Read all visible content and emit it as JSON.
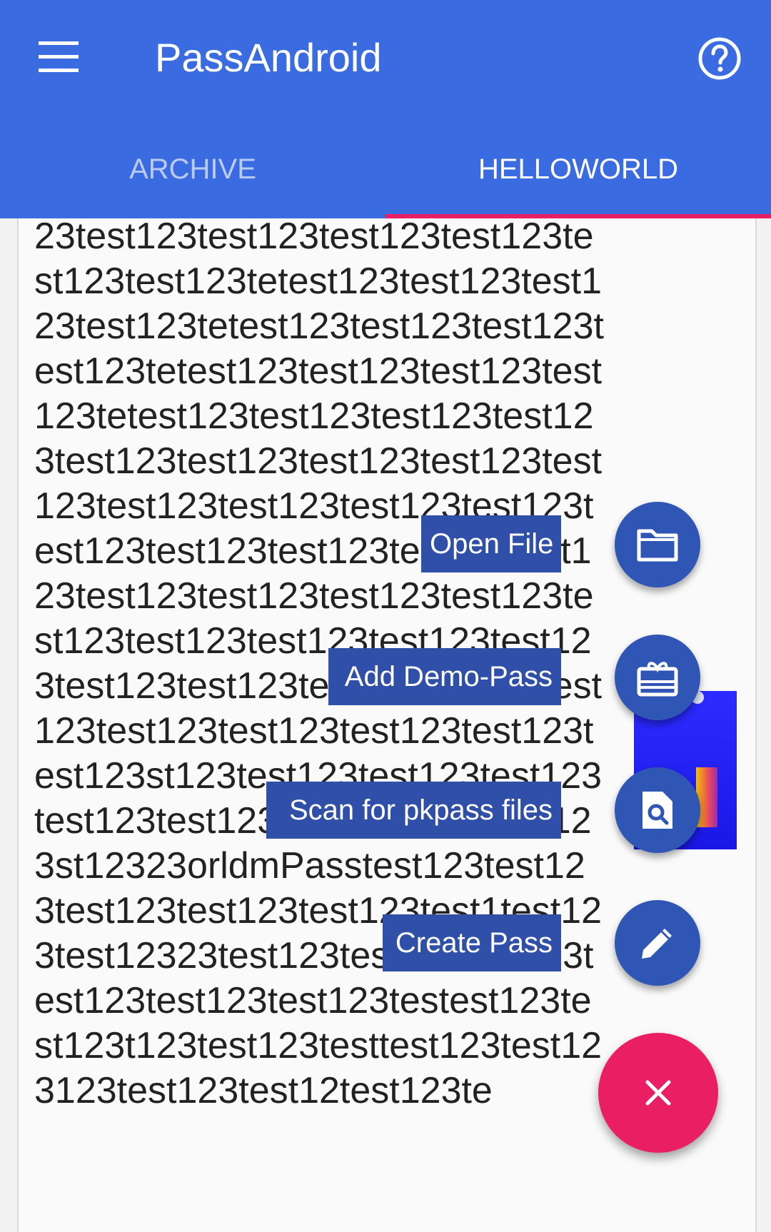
{
  "appbar": {
    "title": "PassAndroid",
    "menu_icon": "hamburger-menu-icon",
    "help_icon": "help-circle-icon",
    "color": "#3A6BE0"
  },
  "tabs": [
    {
      "label": "ARCHIVE",
      "selected": false
    },
    {
      "label": "HELLOWORLD",
      "selected": true
    }
  ],
  "tab_indicator_color": "#E91E63",
  "content": {
    "text": "23test123test123test123test123test123test123tetest123test123test123test123tetest123test123test123test123tetest123test123test123test123tetest123test123test123test123test123test123test123test123test123test123test123test123test123test123test123test123test123test123test123test123test123test123test123test123test123test123test123test123test123test123test123test123test123test123test123test123test123st123test123test123test123test123test123st123test123test123st12323orldmPasstest123test123test123test123test123test1test123test12323test123test123test123test123test123test123testest123test123t123test123testtest123test123123test123test12test123te"
  },
  "speed_dial": {
    "items": [
      {
        "label": "Open File",
        "icon": "folder-icon"
      },
      {
        "label": "Add Demo-Pass",
        "icon": "gift-card-icon"
      },
      {
        "label": "Scan for pkpass files",
        "icon": "file-search-icon"
      },
      {
        "label": "Create Pass",
        "icon": "pencil-icon"
      }
    ],
    "main_icon": "close-icon",
    "main_color": "#E91E63",
    "mini_color": "#2F55B5"
  }
}
